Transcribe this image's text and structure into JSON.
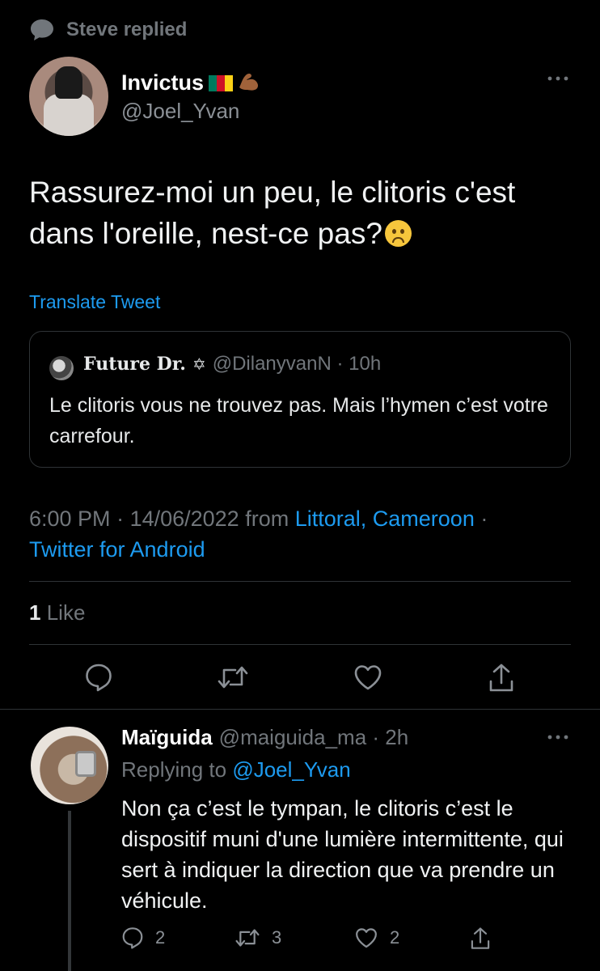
{
  "social_context": {
    "text": "Steve replied"
  },
  "author": {
    "name": "Invictus",
    "handle": "@Joel_Yvan",
    "flag_colors": [
      "#007a5e",
      "#ce1126",
      "#fcd116"
    ]
  },
  "tweet": {
    "text": "Rassurez-moi un peu, le clitoris c'est dans l'oreille, nest-ce pas?",
    "emoji": "slightly-frowning-face",
    "translate_label": "Translate Tweet"
  },
  "quoted": {
    "name": "Future Dr.",
    "badge": "✡",
    "handle": "@DilanyvanN",
    "time": "10h",
    "text": "Le clitoris vous ne trouvez pas. Mais l’hymen c’est votre carrefour."
  },
  "meta": {
    "time": "6:00 PM",
    "date": "14/06/2022",
    "from_label": "from",
    "location": "Littoral, Cameroon",
    "client": "Twitter for Android"
  },
  "stats": {
    "likes_count": "1",
    "likes_label": "Like"
  },
  "actions": [
    "reply-icon",
    "retweet-icon",
    "like-icon",
    "share-icon"
  ],
  "reply": {
    "name": "Maïguida",
    "handle": "@maiguida_ma",
    "time": "2h",
    "replying_label": "Replying to",
    "replying_to": "@Joel_Yvan",
    "text": "Non ça c’est le tympan, le clitoris c’est le dispositif muni d'une lumière intermittente, qui sert à indiquer la direction que va prendre un véhicule.",
    "reply_count": "2",
    "retweet_count": "3",
    "like_count": "2"
  },
  "colors": {
    "background": "#000000",
    "accent": "#1d9bf0",
    "muted": "#71767b",
    "divider": "#2f3336"
  }
}
